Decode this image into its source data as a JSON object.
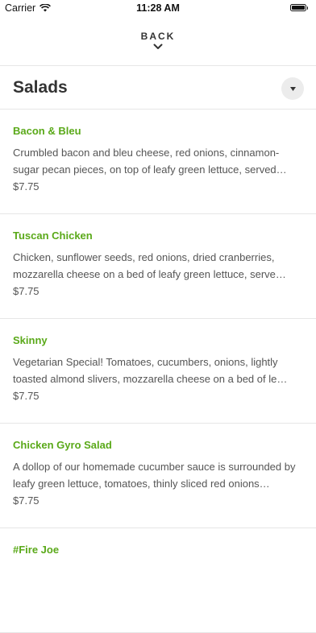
{
  "status_bar": {
    "carrier": "Carrier",
    "time": "11:28 AM"
  },
  "nav": {
    "back_label": "BACK"
  },
  "section": {
    "title": "Salads"
  },
  "colors": {
    "accent_green": "#5aa919",
    "text": "#333333",
    "muted": "#555555",
    "divider": "#e6e6e6"
  },
  "items": [
    {
      "name": "Bacon & Bleu",
      "description": "Crumbled bacon and bleu cheese, red onions, cinnamon-sugar pecan pieces, on top of leafy green lettuce, served…",
      "price": "$7.75"
    },
    {
      "name": "Tuscan Chicken",
      "description": "Chicken, sunflower seeds, red onions, dried cranberries, mozzarella cheese on a bed of leafy green lettuce, serve…",
      "price": "$7.75"
    },
    {
      "name": "Skinny",
      "description": "Vegetarian Special! Tomatoes, cucumbers, onions, lightly toasted almond slivers, mozzarella cheese on a bed of le…",
      "price": "$7.75"
    },
    {
      "name": "Chicken Gyro Salad",
      "description": "A dollop of our homemade cucumber sauce is surrounded by leafy green lettuce, tomatoes, thinly sliced red onions…",
      "price": "$7.75"
    },
    {
      "name": "#Fire Joe"
    }
  ]
}
